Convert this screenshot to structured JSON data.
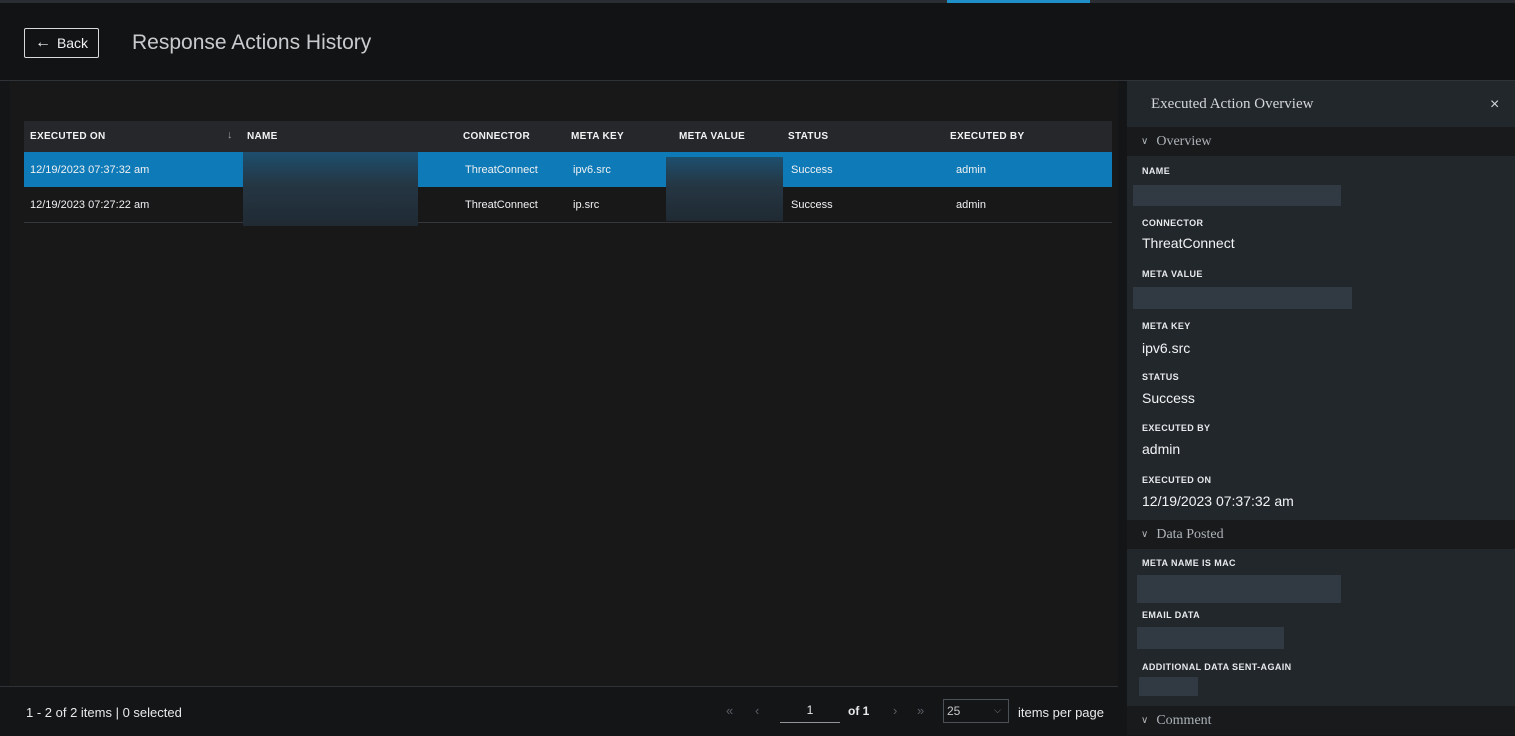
{
  "header": {
    "back_label": "Back",
    "title": "Response Actions History"
  },
  "table": {
    "columns": [
      "EXECUTED ON",
      "NAME",
      "CONNECTOR",
      "META KEY",
      "META VALUE",
      "STATUS",
      "EXECUTED BY"
    ],
    "rows": [
      {
        "executed_on": "12/19/2023 07:37:32 am",
        "connector": "ThreatConnect",
        "meta_key": "ipv6.src",
        "status": "Success",
        "executed_by": "admin",
        "selected": true
      },
      {
        "executed_on": "12/19/2023 07:27:22 am",
        "connector": "ThreatConnect",
        "meta_key": "ip.src",
        "status": "Success",
        "executed_by": "admin",
        "selected": false
      }
    ]
  },
  "footer": {
    "count_text": "1 - 2 of 2 items | 0 selected",
    "page_value": "1",
    "of_text": "of 1",
    "page_size": "25",
    "per_page_label": "items per page"
  },
  "panel": {
    "title": "Executed Action Overview",
    "sections": {
      "overview": "Overview",
      "data_posted": "Data Posted",
      "comment": "Comment"
    },
    "fields": {
      "name_label": "NAME",
      "connector_label": "CONNECTOR",
      "connector_value": "ThreatConnect",
      "meta_value_label": "META VALUE",
      "meta_key_label": "META KEY",
      "meta_key_value": "ipv6.src",
      "status_label": "STATUS",
      "status_value": "Success",
      "executed_by_label": "EXECUTED BY",
      "executed_by_value": "admin",
      "executed_on_label": "EXECUTED ON",
      "executed_on_value": "12/19/2023 07:37:32 am",
      "meta_name_is_mac_label": "META NAME IS MAC",
      "email_data_label": "EMAIL DATA",
      "additional_data_label": "ADDITIONAL DATA SENT-AGAIN"
    }
  },
  "colors": {
    "accent": "#0e7ab8",
    "background": "#141516",
    "panel": "#22272c"
  },
  "icons": {
    "back": "arrow-left-icon",
    "sort": "arrow-down-icon",
    "close": "close-icon",
    "section": "chevron-down-icon"
  }
}
